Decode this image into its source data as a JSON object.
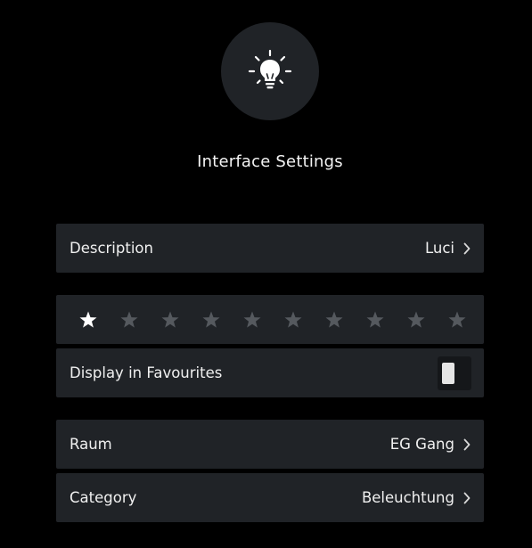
{
  "header": {
    "icon": "lightbulb-icon",
    "title": "Interface Settings"
  },
  "description_row": {
    "label": "Description",
    "value": "Luci"
  },
  "rating": {
    "max": 10,
    "value": 1,
    "colors": {
      "active": "#ffffff",
      "inactive": "#55595e"
    }
  },
  "favourites_row": {
    "label": "Display in Favourites",
    "enabled": false
  },
  "room_row": {
    "label": "Raum",
    "value": "EG Gang"
  },
  "category_row": {
    "label": "Category",
    "value": "Beleuchtung"
  },
  "colors": {
    "background": "#000000",
    "row_background": "#202327",
    "text": "#f0f0f0"
  }
}
